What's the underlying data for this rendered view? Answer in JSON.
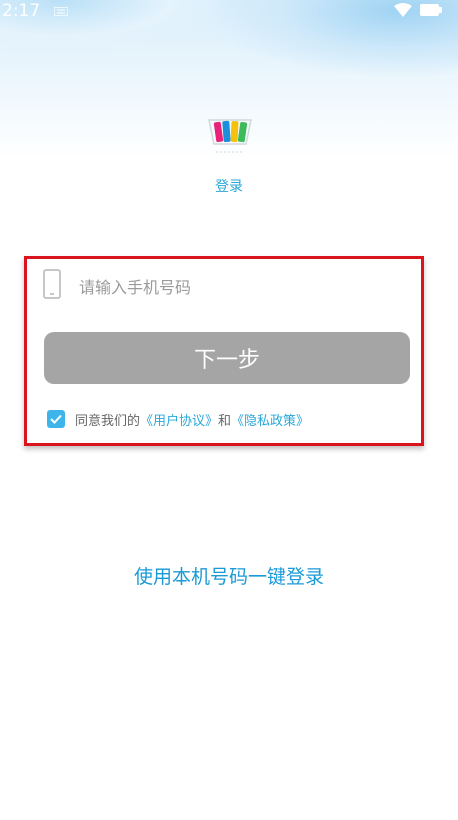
{
  "status_bar": {
    "time": "2:17"
  },
  "app": {
    "title": "登录"
  },
  "form": {
    "phone_placeholder": "请输入手机号码",
    "phone_value": "",
    "next_button_label": "下一步",
    "agreement": {
      "checked": true,
      "prefix": "同意我们的",
      "user_agreement_link": "《用户协议》",
      "connector": "和",
      "privacy_policy_link": "《隐私政策》"
    }
  },
  "one_click_login_label": "使用本机号码一键登录",
  "colors": {
    "accent": "#2aa7d9",
    "button_disabled": "#a5a5a5",
    "highlight_border": "#d9141c",
    "checkbox": "#3db5ea"
  }
}
